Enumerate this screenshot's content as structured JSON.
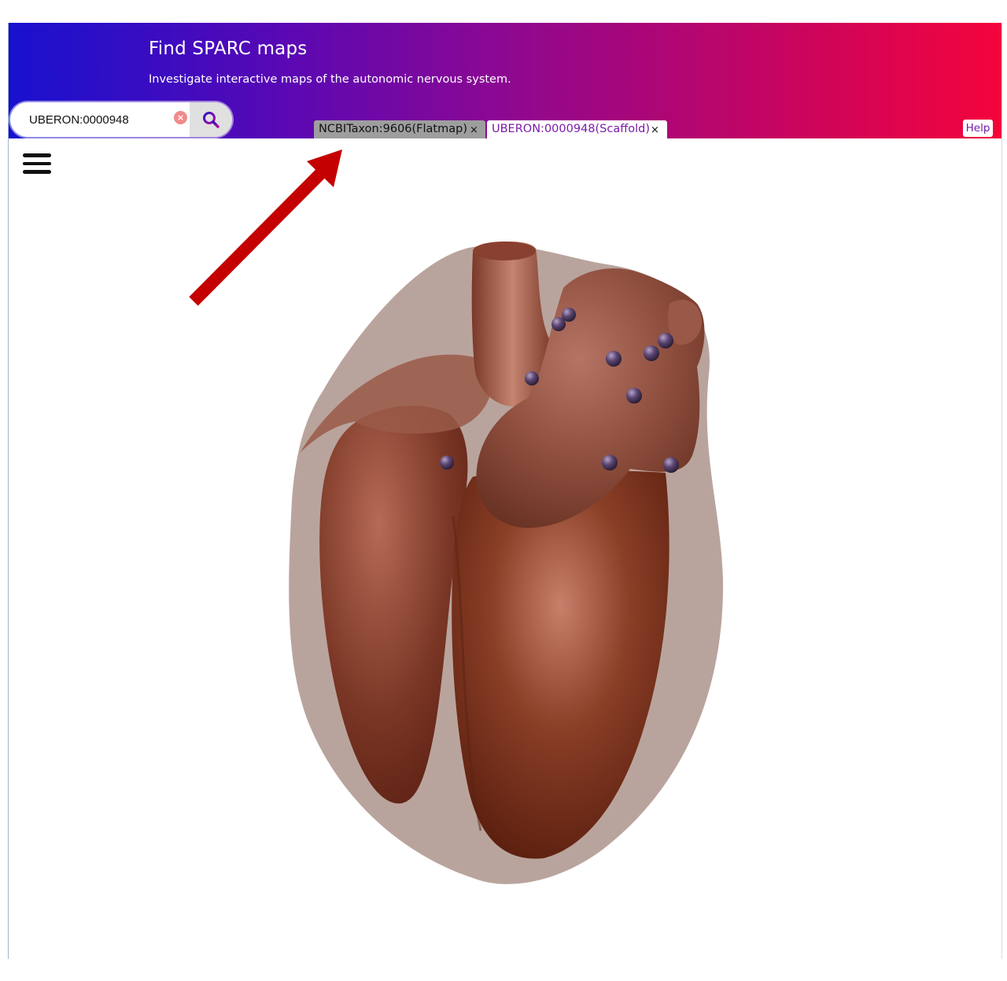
{
  "header": {
    "title": "Find SPARC maps",
    "subtitle": "Investigate interactive maps of the autonomic nervous system."
  },
  "search": {
    "value": "UBERON:0000948",
    "clear_icon": "x-circle-icon",
    "search_icon": "magnifier-icon"
  },
  "tabs": [
    {
      "label": "NCBITaxon:9606(Flatmap)",
      "close": "×",
      "active": false
    },
    {
      "label": "UBERON:0000948(Scaffold)",
      "close": "×",
      "active": true
    }
  ],
  "help": {
    "label": "Help"
  },
  "menu": {
    "icon": "hamburger-menu-icon"
  },
  "viewer": {
    "model": "heart-scaffold-3d",
    "markers_count": 11,
    "colors": {
      "tissue": "#8b4a36",
      "tissue_light": "#c07a63",
      "epicardium": "#a2857c",
      "marker": "#4a3a5c",
      "accent": "#7a1aa8",
      "annotation_arrow": "#c40000"
    }
  }
}
